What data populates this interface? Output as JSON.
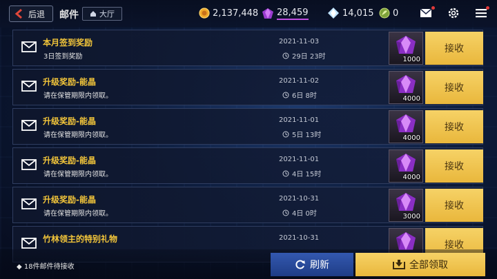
{
  "header": {
    "back_label": "后退",
    "title": "邮件",
    "lobby_label": "大厅"
  },
  "resources": {
    "gold": "2,137,448",
    "gem": "28,459",
    "diamond": "14,015",
    "leaf": "0"
  },
  "colors": {
    "accent_gold": "#f2c53a",
    "claim_button": "#f0c550",
    "refresh_button": "#2a4a9c",
    "gem_purple": "#b84de0",
    "notification_red": "#e23a3a"
  },
  "icons": {
    "back": "back-arrow-icon",
    "home": "home-icon",
    "gold": "gold-coin-icon",
    "gem": "purple-crystal-icon",
    "diamond": "diamond-icon",
    "leaf": "leaf-coin-icon",
    "mail": "mail-icon",
    "settings": "gear-icon",
    "menu": "menu-icon",
    "envelope": "envelope-icon",
    "clock": "clock-icon",
    "refresh": "refresh-icon",
    "claim_all": "claim-all-icon"
  },
  "mails": [
    {
      "title": "本月签到奖励",
      "desc": "3日签到奖励",
      "date": "2021-11-03",
      "remaining": "29日 23时",
      "qty": "1000",
      "claim_label": "接收"
    },
    {
      "title": "升级奖励-能晶",
      "desc": "请在保管期限内领取。",
      "date": "2021-11-02",
      "remaining": "6日 8时",
      "qty": "4000",
      "claim_label": "接收"
    },
    {
      "title": "升级奖励-能晶",
      "desc": "请在保管期限内领取。",
      "date": "2021-11-01",
      "remaining": "5日 13时",
      "qty": "4000",
      "claim_label": "接收"
    },
    {
      "title": "升级奖励-能晶",
      "desc": "请在保管期限内领取。",
      "date": "2021-11-01",
      "remaining": "4日 15时",
      "qty": "4000",
      "claim_label": "接收"
    },
    {
      "title": "升级奖励-能晶",
      "desc": "请在保管期限内领取。",
      "date": "2021-10-31",
      "remaining": "4日 0时",
      "qty": "3000",
      "claim_label": "接收"
    },
    {
      "title": "竹林领主的特别礼物",
      "desc": "",
      "date": "2021-10-31",
      "remaining": "",
      "qty": "",
      "claim_label": "接收"
    }
  ],
  "footer": {
    "pending": "18件邮件待接收",
    "refresh_label": "刷新",
    "claim_all_label": "全部领取"
  }
}
